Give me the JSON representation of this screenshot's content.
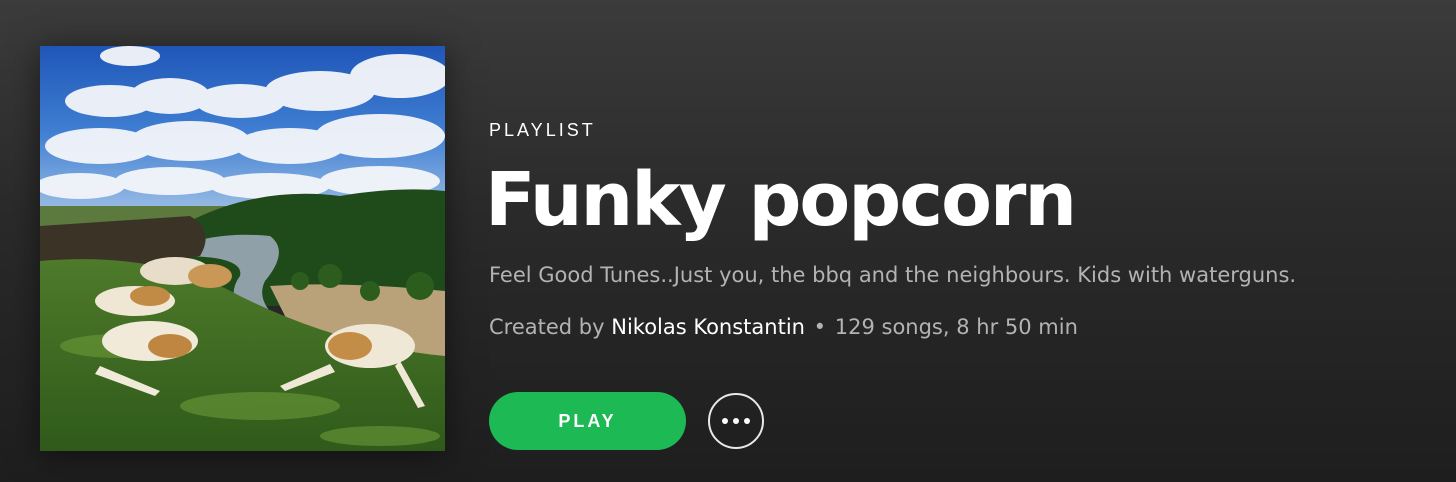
{
  "playlist": {
    "type_label": "PLAYLIST",
    "title": "Funky popcorn",
    "description": "Feel Good Tunes..Just you, the bbq and the neighbours. Kids with waterguns.",
    "created_by_prefix": "Created by",
    "owner": "Nikolas Konstantin",
    "separator": "•",
    "stats": "129 songs, 8 hr 50 min"
  },
  "actions": {
    "play_label": "PLAY",
    "more_icon": "more-options-icon"
  },
  "colors": {
    "accent": "#1db954",
    "background_top": "#3b3b3b",
    "background_bottom": "#1e1e1e",
    "secondary_text": "#b3b3b3"
  }
}
